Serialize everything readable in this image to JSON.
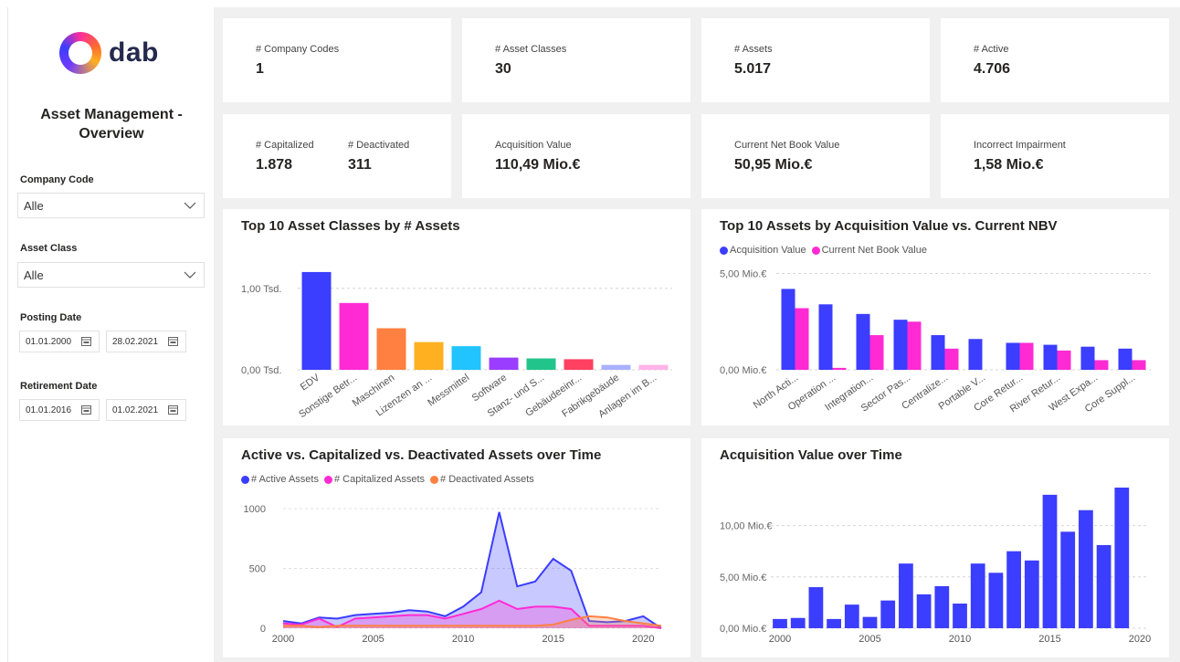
{
  "brand": {
    "name": "dab"
  },
  "report_title": "Asset Management - Overview",
  "filters": {
    "company_code": {
      "label": "Company Code",
      "value": "Alle"
    },
    "asset_class": {
      "label": "Asset Class",
      "value": "Alle"
    },
    "posting_date": {
      "label": "Posting Date",
      "from": "01.01.2000",
      "to": "28.02.2021"
    },
    "retirement_date": {
      "label": "Retirement Date",
      "from": "01.01.2016",
      "to": "01.02.2021"
    }
  },
  "kpis": {
    "company_codes": {
      "label": "# Company Codes",
      "value": "1"
    },
    "asset_classes": {
      "label": "# Asset Classes",
      "value": "30"
    },
    "assets": {
      "label": "# Assets",
      "value": "5.017"
    },
    "active": {
      "label": "# Active",
      "value": "4.706"
    },
    "capitalized": {
      "label": "# Capitalized",
      "value": "1.878"
    },
    "deactivated": {
      "label": "# Deactivated",
      "value": "311"
    },
    "acquisition_value": {
      "label": "Acquisition Value",
      "value": "110,49 Mio.€"
    },
    "current_nbv": {
      "label": "Current Net Book Value",
      "value": "50,95 Mio.€"
    },
    "incorrect_impairment": {
      "label": "Incorrect Impairment",
      "value": "1,58 Mio.€"
    }
  },
  "colors": {
    "blue": "#3b3dff",
    "pink": "#ff2ad4",
    "orange": "#ff8040",
    "yellow": "#ffb020",
    "cyan": "#21c4ff",
    "purple": "#9a3dff",
    "green": "#21c48a",
    "red": "#ff4060",
    "lavender": "#a8b0ff",
    "lightpink": "#ffb3e8"
  },
  "chart_data": [
    {
      "id": "top10_classes",
      "type": "bar",
      "title": "Top 10 Asset Classes by # Assets",
      "categories": [
        "EDV",
        "Sonstige Betr...",
        "Maschinen",
        "Lizenzen an ...",
        "Messmittel",
        "Software",
        "Stanz- und S...",
        "Gebäudeeinr...",
        "Fabrikgebäude",
        "Anlagen im B..."
      ],
      "values": [
        1200,
        820,
        510,
        340,
        290,
        150,
        140,
        130,
        60,
        60
      ],
      "bar_colors": [
        "#3b3dff",
        "#ff2ad4",
        "#ff8040",
        "#ffb020",
        "#21c4ff",
        "#9a3dff",
        "#21c48a",
        "#ff4060",
        "#a8b0ff",
        "#ffb3e8"
      ],
      "ylim": [
        0,
        1300
      ],
      "yticks": [
        {
          "value": 0,
          "label": "0,00 Tsd."
        },
        {
          "value": 1000,
          "label": "1,00 Tsd."
        }
      ]
    },
    {
      "id": "top10_assets",
      "type": "bar",
      "title": "Top 10 Assets by Acquisition Value vs. Current NBV",
      "categories": [
        "North Acti...",
        "Operation ...",
        "Integration...",
        "Sector Pas...",
        "Centralize...",
        "Portable V...",
        "Core Retur...",
        "River Retur...",
        "West Expa...",
        "Core Suppl..."
      ],
      "series": [
        {
          "name": "Acquisition Value",
          "color": "#3b3dff",
          "values": [
            4.2,
            3.4,
            2.9,
            2.6,
            1.8,
            1.6,
            1.4,
            1.3,
            1.2,
            1.1
          ]
        },
        {
          "name": "Current Net Book Value",
          "color": "#ff2ad4",
          "values": [
            3.2,
            0.1,
            1.8,
            2.5,
            1.1,
            0,
            1.4,
            1.0,
            0.5,
            0.5
          ]
        }
      ],
      "ylim": [
        0,
        5.5
      ],
      "yticks": [
        {
          "value": 0,
          "label": "0,00 Mio.€"
        },
        {
          "value": 5,
          "label": "5,00 Mio.€"
        }
      ]
    },
    {
      "id": "assets_over_time",
      "type": "area",
      "title": "Active vs. Capitalized vs. Deactivated Assets over Time",
      "x": [
        2000,
        2001,
        2002,
        2003,
        2004,
        2005,
        2006,
        2007,
        2008,
        2009,
        2010,
        2011,
        2012,
        2013,
        2014,
        2015,
        2016,
        2017,
        2018,
        2019,
        2020,
        2021
      ],
      "series": [
        {
          "name": "# Active Assets",
          "color": "#3b3dff",
          "values": [
            60,
            40,
            90,
            80,
            110,
            120,
            130,
            150,
            140,
            100,
            180,
            300,
            970,
            350,
            390,
            580,
            480,
            60,
            50,
            60,
            100,
            0
          ]
        },
        {
          "name": "# Capitalized Assets",
          "color": "#ff2ad4",
          "values": [
            40,
            30,
            80,
            10,
            80,
            90,
            100,
            110,
            110,
            80,
            120,
            160,
            230,
            160,
            180,
            180,
            160,
            20,
            20,
            20,
            20,
            0
          ]
        },
        {
          "name": "# Deactivated Assets",
          "color": "#ff8040",
          "values": [
            20,
            20,
            10,
            20,
            20,
            20,
            20,
            20,
            20,
            20,
            20,
            20,
            20,
            20,
            20,
            30,
            70,
            100,
            90,
            60,
            40,
            20
          ]
        }
      ],
      "ylim": [
        0,
        1000
      ],
      "yticks": [
        {
          "value": 0,
          "label": "0"
        },
        {
          "value": 500,
          "label": "500"
        },
        {
          "value": 1000,
          "label": "1000"
        }
      ],
      "xticks": [
        2000,
        2005,
        2010,
        2015,
        2020
      ]
    },
    {
      "id": "acq_over_time",
      "type": "bar",
      "title": "Acquisition Value over Time",
      "x": [
        2000,
        2001,
        2002,
        2003,
        2004,
        2005,
        2006,
        2007,
        2008,
        2009,
        2010,
        2011,
        2012,
        2013,
        2014,
        2015,
        2016,
        2017,
        2018,
        2019
      ],
      "values": [
        0.9,
        1.0,
        4.0,
        0.9,
        2.3,
        1.1,
        2.7,
        6.3,
        3.3,
        4.1,
        2.4,
        6.3,
        5.4,
        7.5,
        6.6,
        13.0,
        9.4,
        11.5,
        8.1,
        13.7
      ],
      "color": "#3b3dff",
      "ylim": [
        0,
        14.5
      ],
      "yticks": [
        {
          "value": 0,
          "label": "0,00 Mio.€"
        },
        {
          "value": 5,
          "label": "5,00 Mio.€"
        },
        {
          "value": 10,
          "label": "10,00 Mio.€"
        }
      ],
      "xticks": [
        2000,
        2005,
        2010,
        2015,
        2020
      ]
    }
  ]
}
